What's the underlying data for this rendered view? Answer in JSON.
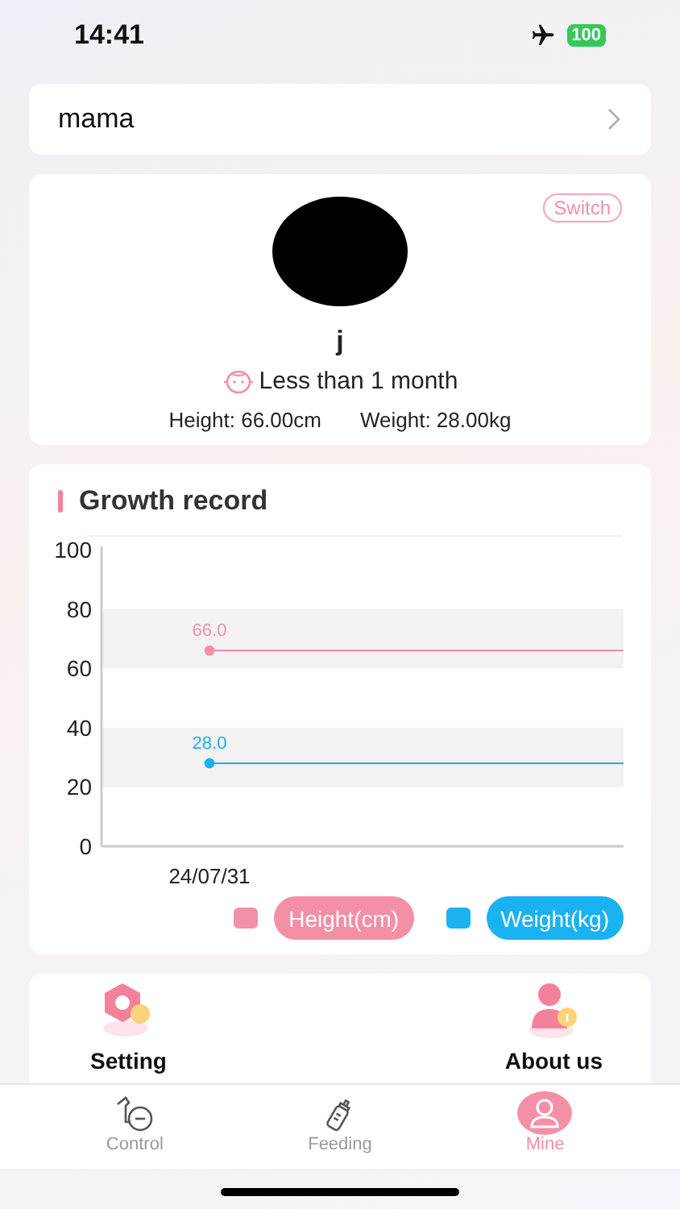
{
  "status_bar": {
    "time": "14:41",
    "battery": "100"
  },
  "account": {
    "name": "mama"
  },
  "profile": {
    "switch_label": "Switch",
    "name": "j",
    "age": "Less than 1 month",
    "height": "Height: 66.00cm",
    "weight": "Weight: 28.00kg"
  },
  "growth_record": {
    "title": "Growth record",
    "chart_data": {
      "type": "line",
      "categories": [
        "24/07/31"
      ],
      "ylim": [
        0,
        100
      ],
      "yticks": [
        0,
        20,
        40,
        60,
        80,
        100
      ],
      "data_labels": true,
      "series": [
        {
          "name": "Height(cm)",
          "color": "#f48fa8",
          "values": [
            66.0
          ],
          "value_labels": [
            "66.0"
          ],
          "marker": "circle"
        },
        {
          "name": "Weight(kg)",
          "color": "#1ab2f0",
          "values": [
            28.0
          ],
          "value_labels": [
            "28.0"
          ],
          "marker": "circle"
        }
      ],
      "ref_lines": [
        {
          "axis": "y",
          "value": 66.0,
          "color": "#f48fa8"
        },
        {
          "axis": "y",
          "value": 28.0,
          "color": "#1ab2f0"
        }
      ]
    }
  },
  "menu": [
    {
      "label": "Setting",
      "kind": "setting"
    },
    {
      "label": "About us",
      "kind": "about"
    }
  ],
  "tabs": [
    {
      "label": "Control",
      "kind": "pump",
      "selected": false
    },
    {
      "label": "Feeding",
      "kind": "bottle",
      "selected": false
    },
    {
      "label": "Mine",
      "kind": "person",
      "selected": true
    }
  ]
}
